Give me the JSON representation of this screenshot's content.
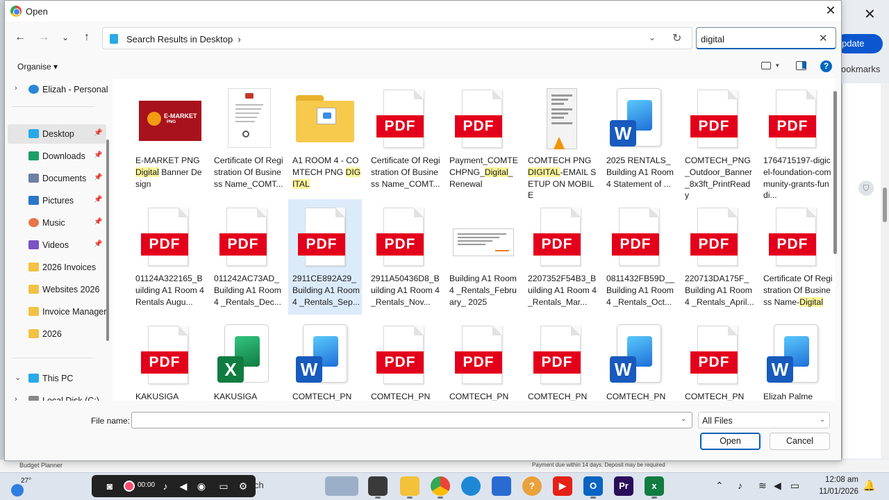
{
  "background": {
    "update_label": "pdate",
    "bookmarks_label": "ookmarks",
    "bottom_left_text": "Budget Planner",
    "bottom_right_text": "Payment due within 14 days. Deposit may be required"
  },
  "dialog": {
    "title": "Open",
    "breadcrumb": "Search Results in Desktop",
    "search_value": "digital",
    "organise_label": "Organise ▾"
  },
  "sidebar": {
    "items": [
      {
        "label": "Elizah - Personal",
        "icon": "cloud-icon",
        "color": "#2b88d8"
      },
      {
        "label": "Desktop",
        "icon": "desktop-icon",
        "color": "#29a9e8"
      },
      {
        "label": "Downloads",
        "icon": "download-icon",
        "color": "#1e9e6a"
      },
      {
        "label": "Documents",
        "icon": "documents-icon",
        "color": "#6d7fa3"
      },
      {
        "label": "Pictures",
        "icon": "pictures-icon",
        "color": "#2a77c9"
      },
      {
        "label": "Music",
        "icon": "music-icon",
        "color": "#e8744a"
      },
      {
        "label": "Videos",
        "icon": "videos-icon",
        "color": "#7b52c4"
      },
      {
        "label": "2026 Invoices",
        "icon": "folder-icon",
        "color": "#f2c244"
      },
      {
        "label": "Websites 2026",
        "icon": "folder-icon",
        "color": "#f2c244"
      },
      {
        "label": "Invoice Manager",
        "icon": "folder-icon",
        "color": "#f2c244"
      },
      {
        "label": "2026",
        "icon": "folder-icon",
        "color": "#f2c244"
      },
      {
        "label": "This PC",
        "icon": "pc-icon",
        "color": "#29a9e8"
      },
      {
        "label": "Local Disk (C:)",
        "icon": "disk-icon",
        "color": "#888888"
      }
    ]
  },
  "files": [
    {
      "pre": "E-MARKET PNG ",
      "hl": "Digital",
      "post": " Banner Design",
      "type": "image-emarket",
      "thumb_title": "E-MARKET",
      "thumb_sub": "PNG"
    },
    {
      "pre": "Certificate Of Registration Of Business Name_COMT...",
      "hl": "",
      "post": "",
      "type": "cert"
    },
    {
      "pre": "A1 ROOM 4 - COMTECH PNG ",
      "hl": "DIGITAL",
      "post": "",
      "type": "folder"
    },
    {
      "pre": "Certificate Of Registration Of Business Name_COMT...",
      "hl": "",
      "post": "",
      "type": "pdf"
    },
    {
      "pre": "Payment_COMTECHPNG_",
      "hl": "Digital",
      "post": "_Renewal",
      "type": "pdf"
    },
    {
      "pre": "COMTECH PNG ",
      "hl": "DIGITAL",
      "post": "-EMAIL SETUP ON MOBILE",
      "type": "phone"
    },
    {
      "pre": "2025 RENTALS_Building A1 Room 4 Statement of ...",
      "hl": "",
      "post": "",
      "type": "word"
    },
    {
      "pre": "COMTECH_PNG_Outdoor_Banner_8x3ft_PrintReady",
      "hl": "",
      "post": "",
      "type": "pdf"
    },
    {
      "pre": "1764715197-digicel-foundation-community-grants-fundi...",
      "hl": "",
      "post": "",
      "type": "pdf"
    },
    {
      "pre": "01124A322165_Building A1 Room 4 Rentals Augu...",
      "hl": "",
      "post": "",
      "type": "pdf"
    },
    {
      "pre": "011242AC73AD_Building A1 Room 4 _Rentals_Dec...",
      "hl": "",
      "post": "",
      "type": "pdf"
    },
    {
      "pre": "2911CE892A29_Building A1 Room 4 _Rentals_Sep...",
      "hl": "",
      "post": "",
      "type": "pdf",
      "selected": true
    },
    {
      "pre": "2911A50436D8_Building A1 Room 4 _Rentals_Nov...",
      "hl": "",
      "post": "",
      "type": "pdf"
    },
    {
      "pre": "Building A1 Room 4 _Rentals_February_ 2025",
      "hl": "",
      "post": "",
      "type": "letter"
    },
    {
      "pre": "2207352F54B3_Building A1 Room 4 _Rentals_Mar...",
      "hl": "",
      "post": "",
      "type": "pdf"
    },
    {
      "pre": "0811432FB59D__Building A1 Room 4 _Rentals_Oct...",
      "hl": "",
      "post": "",
      "type": "pdf"
    },
    {
      "pre": "220713DA175F_Building A1 Room 4 _Rentals_April...",
      "hl": "",
      "post": "",
      "type": "pdf"
    },
    {
      "pre": "Certificate Of Registration Of Business Name-",
      "hl": "Digital",
      "post": "",
      "type": "pdf"
    },
    {
      "pre": "KAKUSIGA",
      "hl": "",
      "post": "",
      "type": "pdf"
    },
    {
      "pre": "KAKUSIGA",
      "hl": "",
      "post": "",
      "type": "excel"
    },
    {
      "pre": "COMTECH_PN",
      "hl": "",
      "post": "",
      "type": "word"
    },
    {
      "pre": "COMTECH_PN",
      "hl": "",
      "post": "",
      "type": "pdf"
    },
    {
      "pre": "COMTECH_PN",
      "hl": "",
      "post": "",
      "type": "pdf"
    },
    {
      "pre": "COMTECH_PN",
      "hl": "",
      "post": "",
      "type": "pdf"
    },
    {
      "pre": "COMTECH_PN",
      "hl": "",
      "post": "",
      "type": "word"
    },
    {
      "pre": "COMTECH_PN",
      "hl": "",
      "post": "",
      "type": "pdf"
    },
    {
      "pre": "Elizah Palme",
      "hl": "",
      "post": "",
      "type": "word"
    }
  ],
  "pdf_label": "PDF",
  "word_letter": "W",
  "excel_letter": "X",
  "footer": {
    "file_name_label": "File name:",
    "file_name_value": "",
    "filter_value": "All Files",
    "open_label": "Open",
    "cancel_label": "Cancel"
  },
  "taskbar": {
    "temperature": "27°",
    "timer": "00:00",
    "search_fragment": "ch",
    "time": "12:08 am",
    "date": "11/01/2026"
  }
}
